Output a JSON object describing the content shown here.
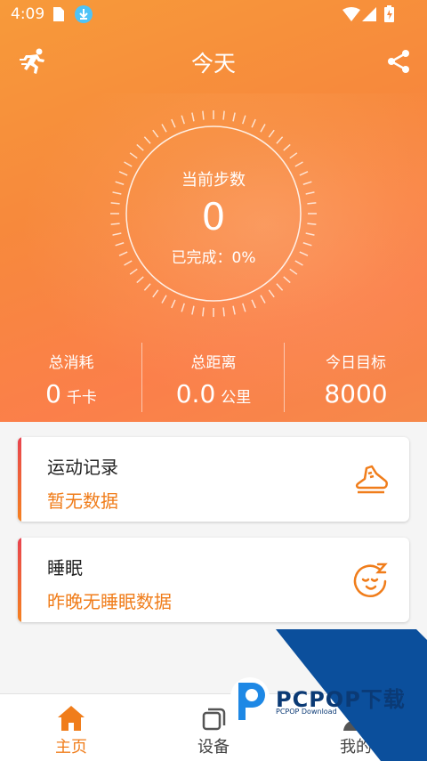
{
  "status_bar": {
    "time": "4:09"
  },
  "header": {
    "title": "今天"
  },
  "dial": {
    "label": "当前步数",
    "value": "0",
    "progress": "已完成：0%"
  },
  "stats": [
    {
      "label": "总消耗",
      "value": "0",
      "unit": "千卡"
    },
    {
      "label": "总距离",
      "value": "0.0",
      "unit": "公里"
    },
    {
      "label": "今日目标",
      "value": "8000",
      "unit": ""
    }
  ],
  "cards": [
    {
      "title": "运动记录",
      "subtitle": "暂无数据",
      "icon": "sneaker-icon"
    },
    {
      "title": "睡眠",
      "subtitle": "昨晚无睡眠数据",
      "icon": "sleep-face-icon"
    }
  ],
  "tabs": [
    {
      "label": "主页",
      "icon": "home-icon",
      "active": true
    },
    {
      "label": "设备",
      "icon": "device-icon",
      "active": false
    },
    {
      "label": "我的",
      "icon": "profile-icon",
      "active": false
    }
  ],
  "watermark": {
    "brand": "PCPOP下载",
    "sub": "PCPOP Download"
  },
  "colors": {
    "accent": "#f07d1b",
    "card_bar_top": "#e8434f",
    "header": "#f7893c"
  }
}
